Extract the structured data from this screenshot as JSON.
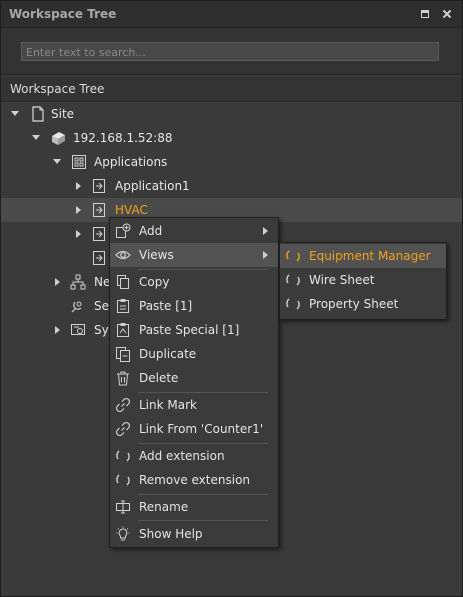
{
  "panel": {
    "title": "Workspace Tree"
  },
  "search": {
    "placeholder": "Enter text to search..."
  },
  "tree": {
    "header": "Workspace Tree",
    "nodes": {
      "site": "Site",
      "device": "192.168.1.52:88",
      "applications": "Applications",
      "application1": "Application1",
      "hvac": "HVAC",
      "node4": "",
      "node5": "",
      "network": "Ne",
      "services": "Ser",
      "system": "Sys"
    }
  },
  "context_menu": {
    "add": "Add",
    "views": "Views",
    "copy": "Copy",
    "paste": "Paste [1]",
    "paste_special": "Paste Special [1]",
    "duplicate": "Duplicate",
    "delete": "Delete",
    "link_mark": "Link Mark",
    "link_from": "Link From 'Counter1'",
    "add_extension": "Add extension",
    "remove_extension": "Remove extension",
    "rename": "Rename",
    "show_help": "Show Help"
  },
  "views_submenu": {
    "equipment_manager": "Equipment Manager",
    "wire_sheet": "Wire Sheet",
    "property_sheet": "Property Sheet"
  },
  "colors": {
    "accent": "#f0a01e",
    "background": "#3a3a3a",
    "menu": "#3b3b3b",
    "highlight": "#525252"
  }
}
